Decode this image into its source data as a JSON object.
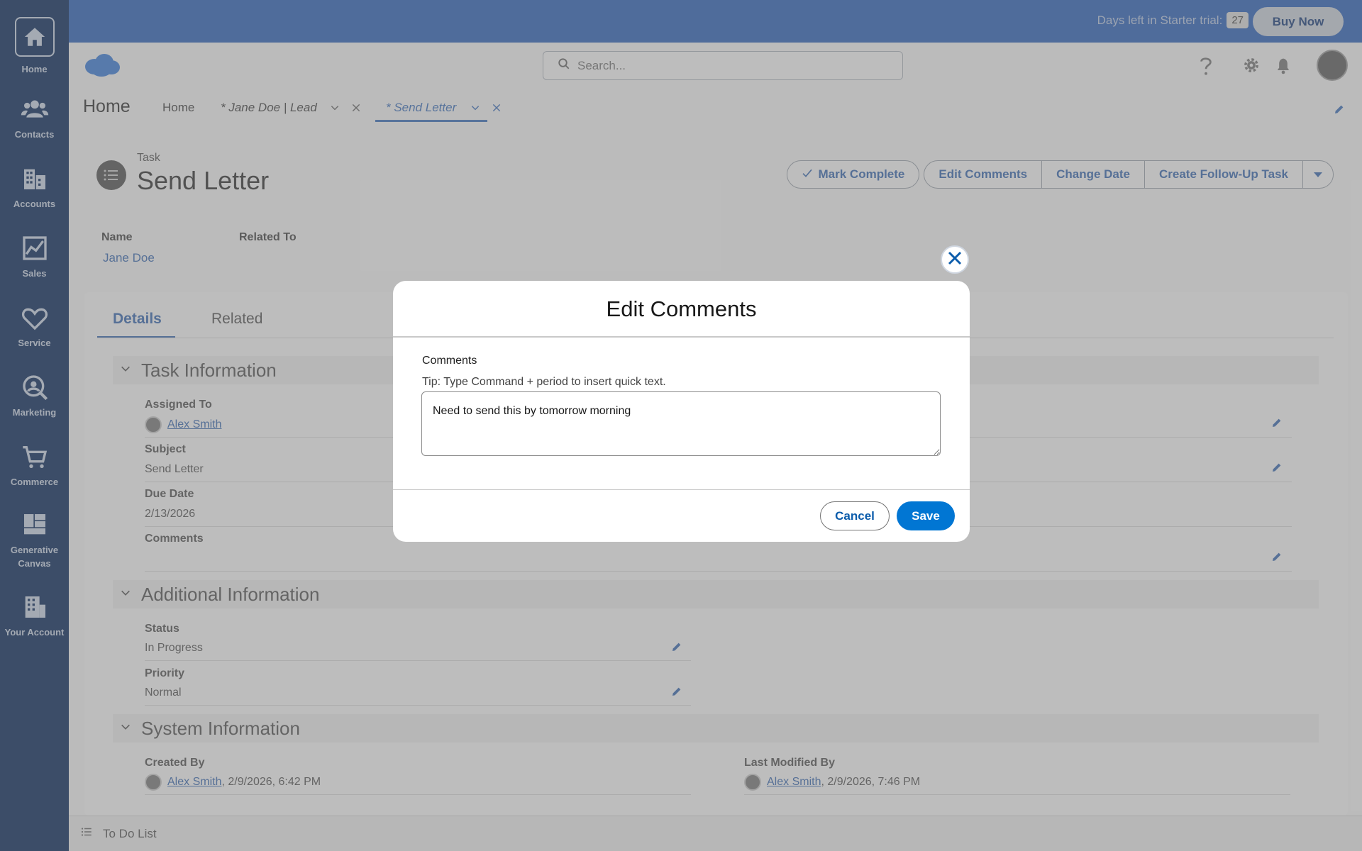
{
  "rail": {
    "items": [
      {
        "label": "Home"
      },
      {
        "label": "Contacts"
      },
      {
        "label": "Accounts"
      },
      {
        "label": "Sales"
      },
      {
        "label": "Service"
      },
      {
        "label": "Marketing"
      },
      {
        "label": "Commerce"
      },
      {
        "label": "Generative Canvas"
      },
      {
        "label": "Your Account"
      }
    ]
  },
  "topbar": {
    "trial_text": "Days left in Starter trial:",
    "trial_days": "27",
    "buy_now": "Buy Now"
  },
  "header": {
    "search_placeholder": "Search...",
    "app_title": "Home",
    "tabs": [
      {
        "label": "Home"
      },
      {
        "label": "* Jane Doe | Lead"
      },
      {
        "label": "* Send Letter"
      }
    ]
  },
  "record": {
    "type": "Task",
    "title": "Send Letter",
    "actions": {
      "mark_complete": "Mark Complete",
      "edit_comments": "Edit Comments",
      "change_date": "Change Date",
      "create_follow_up": "Create Follow-Up Task"
    },
    "highlights": {
      "name_label": "Name",
      "name_value": "Jane Doe",
      "related_label": "Related To"
    },
    "detail_tabs": [
      "Details",
      "Related"
    ],
    "sections": {
      "task_information": "Task Information",
      "additional_information": "Additional Information",
      "system_information": "System Information"
    },
    "fields": {
      "assigned_to_label": "Assigned To",
      "assigned_to_value": "Alex Smith",
      "subject_label": "Subject",
      "subject_value": "Send Letter",
      "due_date_label": "Due Date",
      "due_date_value": "2/13/2026",
      "comments_label": "Comments",
      "status_label": "Status",
      "status_value": "In Progress",
      "priority_label": "Priority",
      "priority_value": "Normal",
      "created_by_label": "Created By",
      "created_by_user": "Alex Smith",
      "created_by_date": ", 2/9/2026, 6:42 PM",
      "last_modified_label": "Last Modified By",
      "last_modified_user": "Alex Smith",
      "last_modified_date": ", 2/9/2026, 7:46 PM"
    }
  },
  "footer": {
    "todo": "To Do List"
  },
  "modal": {
    "title": "Edit Comments",
    "field_label": "Comments",
    "tip": "Tip: Type Command + period to insert quick text.",
    "value": "Need to send this by tomorrow morning",
    "cancel": "Cancel",
    "save": "Save"
  },
  "colors": {
    "rail_bg": "#0b2a5c",
    "topbar_bg": "#2f63b8",
    "brand_blue": "#0176d3",
    "link_blue": "#3b6ab0"
  },
  "icons": [
    "home-icon",
    "contacts-icon",
    "accounts-icon",
    "sales-icon",
    "service-icon",
    "marketing-icon",
    "commerce-icon",
    "generative-canvas-icon",
    "your-account-icon",
    "search-icon",
    "help-icon",
    "gear-icon",
    "bell-icon",
    "close-icon",
    "chevron-down-icon",
    "pencil-icon",
    "check-icon",
    "task-icon",
    "cloud-logo-icon",
    "todo-list-icon"
  ]
}
